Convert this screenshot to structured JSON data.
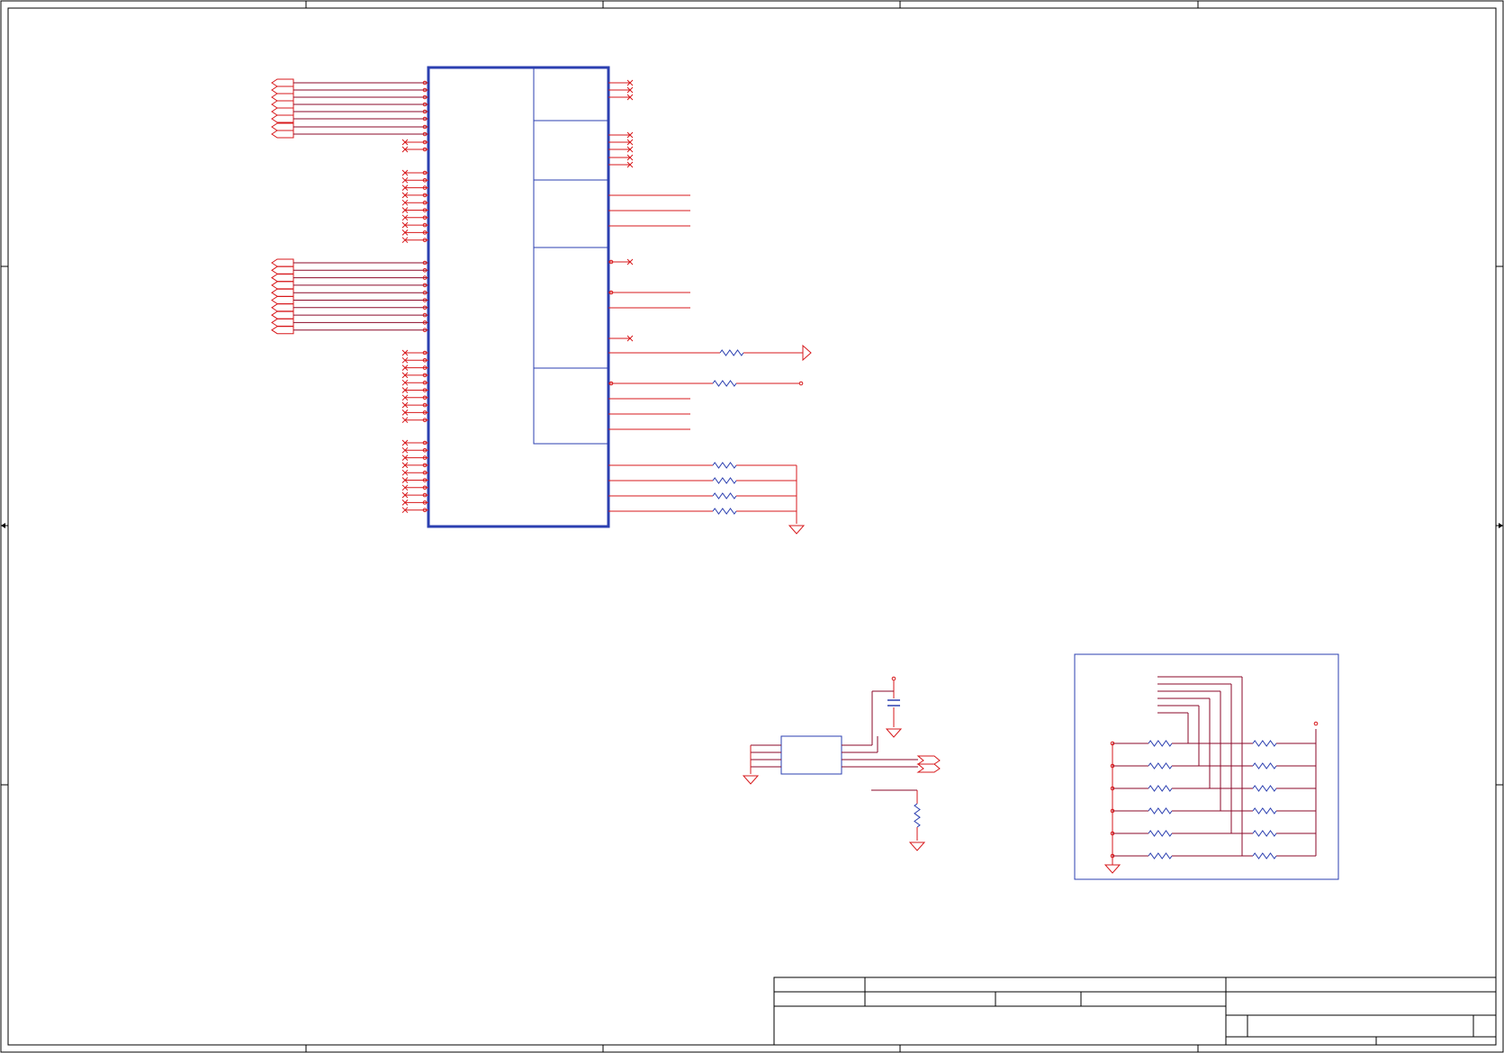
{
  "schematic": {
    "colors": {
      "wire": "#d7191c",
      "net": "#8b0a2a",
      "component": "#2b3fb0",
      "frame": "#000000",
      "background": "#ffffff"
    },
    "left_bus_1": {
      "offpage_connectors": 8,
      "no_connect_pins": 2
    },
    "left_nc_group_1": {
      "no_connect_pins": 10
    },
    "left_bus_2": {
      "offpage_connectors": 10
    },
    "left_nc_group_2": {
      "no_connect_pins": 10
    },
    "left_nc_group_3": {
      "no_connect_pins": 10
    },
    "ic_main": {
      "sections": 5
    },
    "right_pins": {
      "no_connect_groups": [
        3,
        5,
        1,
        1
      ],
      "open_nets": 8,
      "series_resistors": 2,
      "pulldown_resistors": 4
    },
    "oscillator": {
      "decoupling_caps": 1,
      "resistors": 1,
      "ground_symbols": 3
    },
    "resistor_network": {
      "rows": 6,
      "resistors_per_row": 2,
      "ground_symbols": 1
    },
    "title_block": {
      "rows": 4
    }
  }
}
